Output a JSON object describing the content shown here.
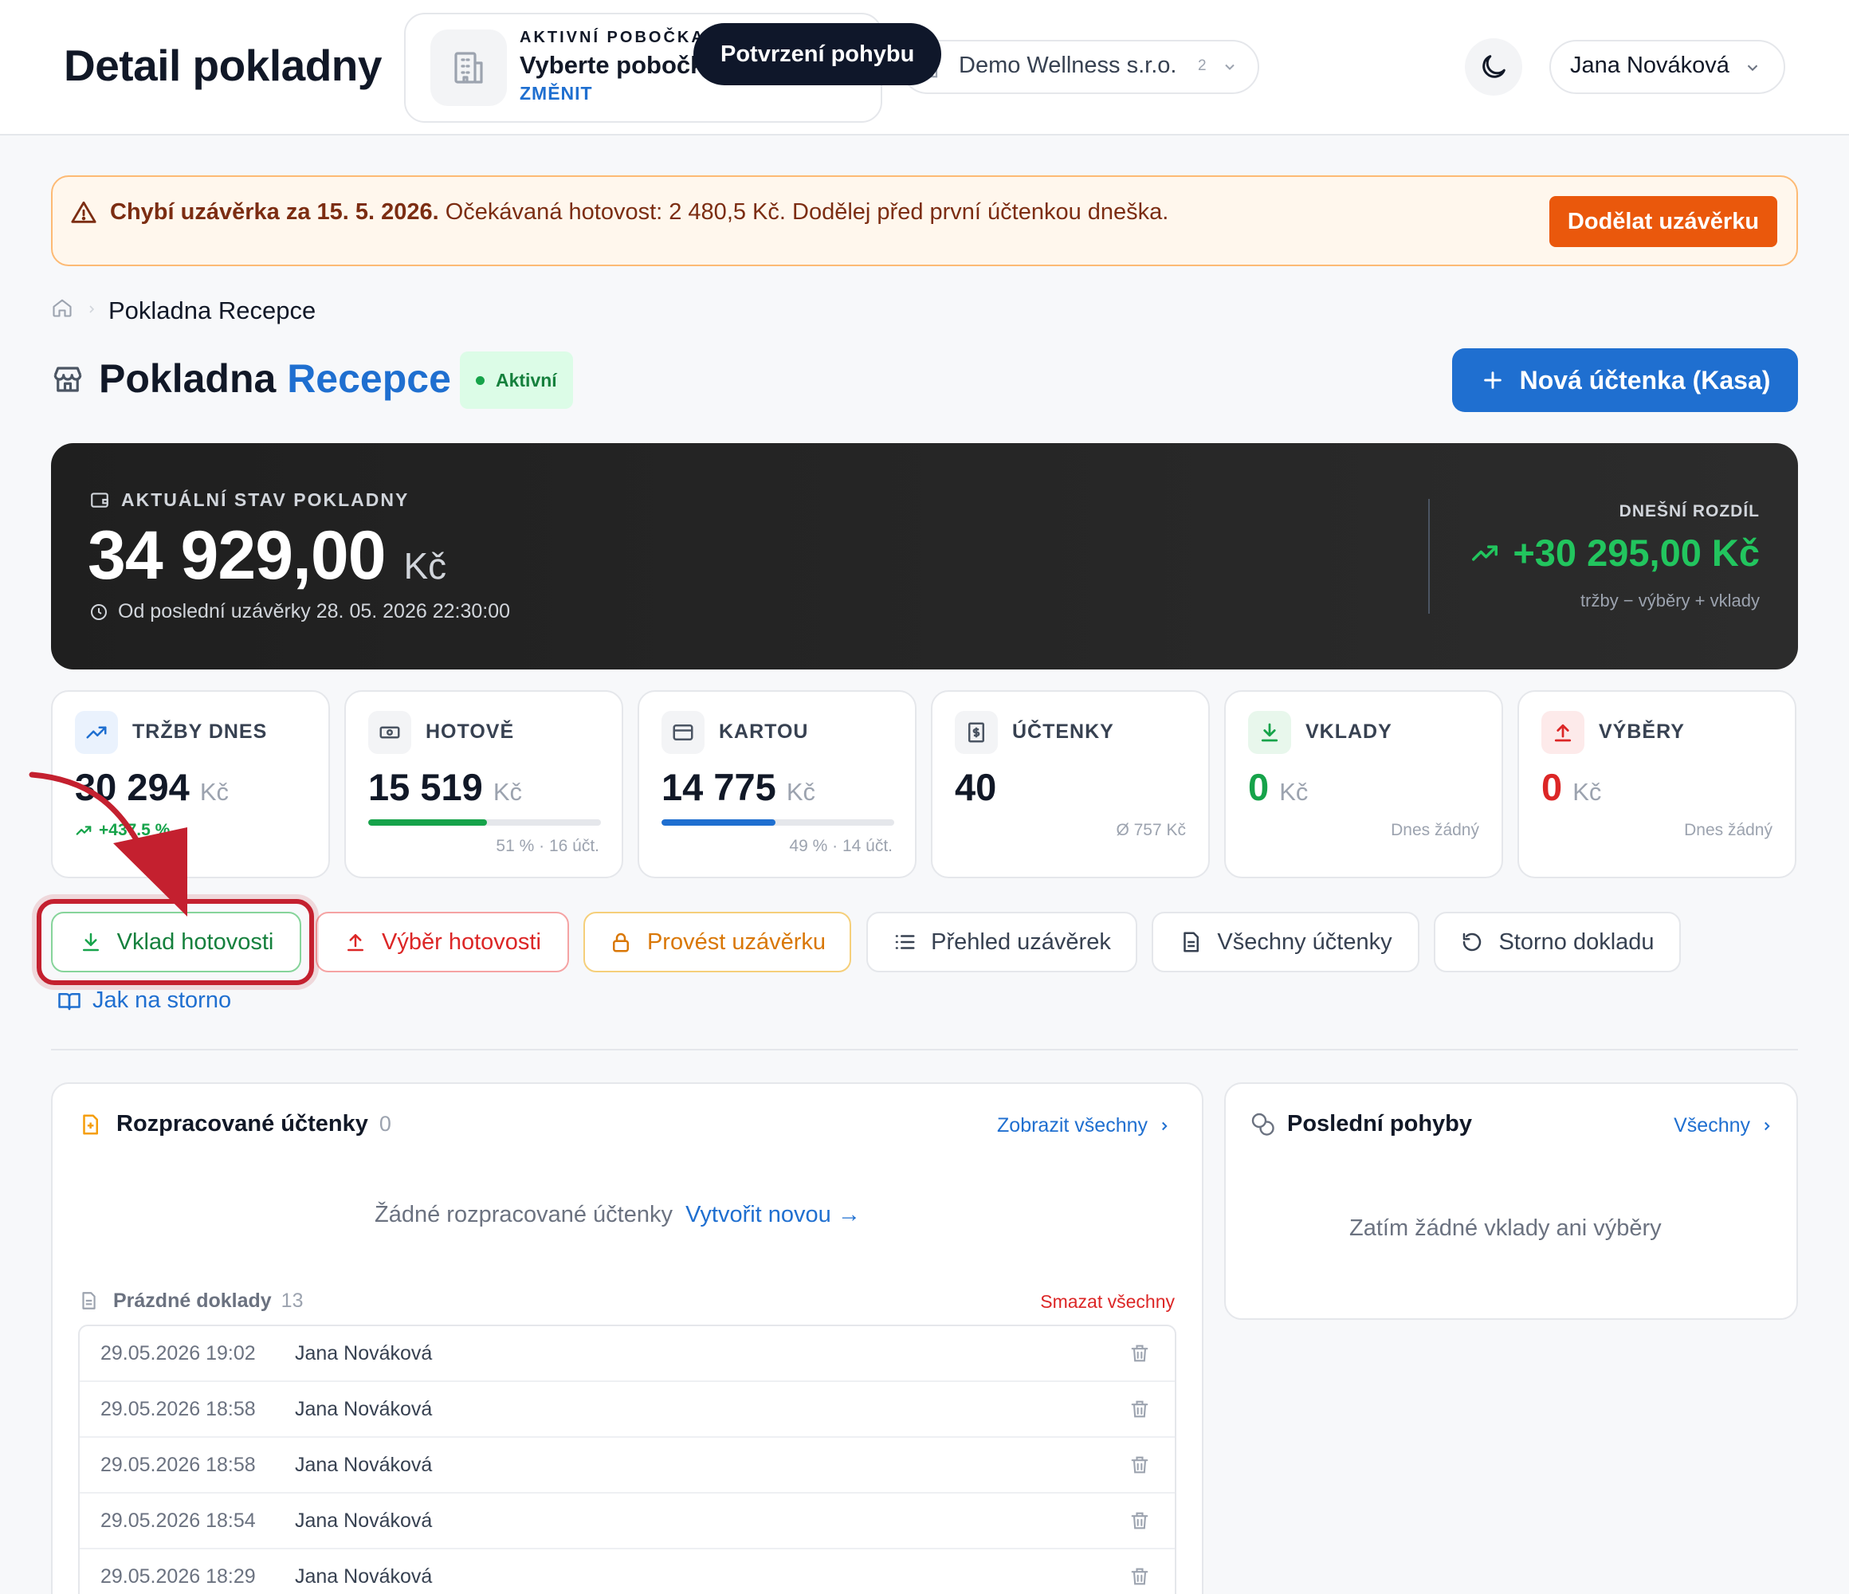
{
  "header": {
    "title": "Detail pokladny",
    "branch_label": "AKTIVNÍ POBOČKA",
    "branch_value": "Vyberte pobočku",
    "branch_change": "ZMĚNIT",
    "tooltip": "Potvrzení pohybu",
    "org_name": "Demo Wellness s.r.o.",
    "org_count": "2",
    "user_name": "Jana Nováková"
  },
  "warning": {
    "bold": "Chybí uzávěrka za 15. 5. 2026.",
    "text": " Očekávaná hotovost: 2 480,5 Kč. Dodělej před první účtenkou dneška.",
    "button": "Dodělat uzávěrku"
  },
  "breadcrumb": {
    "current": "Pokladna Recepce"
  },
  "page": {
    "title_main": "Pokladna ",
    "title_accent": "Recepce",
    "status": "Aktivní",
    "new_button": "Nová účtenka (Kasa)"
  },
  "balance": {
    "label": "AKTUÁLNÍ STAV POKLADNY",
    "value": "34 929,00",
    "unit": "Kč",
    "since": "Od poslední uzávěrky 28. 05. 2026 22:30:00",
    "diff_label": "DNEŠNÍ ROZDÍL",
    "diff_value": "+30 295,00 Kč",
    "diff_note": "tržby − výběry + vklady"
  },
  "stats": {
    "sales": {
      "label": "TRŽBY DNES",
      "value": "30 294",
      "unit": "Kč",
      "trend": "+437.5 %"
    },
    "cash": {
      "label": "HOTOVĚ",
      "value": "15 519",
      "unit": "Kč",
      "share": 0.51,
      "sub": "51 % · 16 účt."
    },
    "card": {
      "label": "KARTOU",
      "value": "14 775",
      "unit": "Kč",
      "share": 0.49,
      "sub": "49 % · 14 účt."
    },
    "receipts": {
      "label": "ÚČTENKY",
      "value": "40",
      "sub": "Ø 757 Kč"
    },
    "deposits": {
      "label": "VKLADY",
      "value": "0",
      "unit": "Kč",
      "sub": "Dnes žádný"
    },
    "withdrawals": {
      "label": "VÝBĚRY",
      "value": "0",
      "unit": "Kč",
      "sub": "Dnes žádný"
    }
  },
  "actions": {
    "deposit": "Vklad hotovosti",
    "withdraw": "Výběr hotovosti",
    "close": "Provést uzávěrku",
    "closings": "Přehled uzávěrek",
    "receipts": "Všechny účtenky",
    "storno": "Storno dokladu",
    "help": "Jak na storno"
  },
  "drafts": {
    "title": "Rozpracované účtenky",
    "count": "0",
    "link": "Zobrazit všechny",
    "empty": "Žádné rozpracované účtenky",
    "create": "Vytvořit novou →",
    "empty_docs_title": "Prázdné doklady",
    "empty_docs_count": "13",
    "delete_all": "Smazat všechny",
    "rows": [
      {
        "date": "29.05.2026 19:02",
        "user": "Jana Nováková"
      },
      {
        "date": "29.05.2026 18:58",
        "user": "Jana Nováková"
      },
      {
        "date": "29.05.2026 18:58",
        "user": "Jana Nováková"
      },
      {
        "date": "29.05.2026 18:54",
        "user": "Jana Nováková"
      },
      {
        "date": "29.05.2026 18:29",
        "user": "Jana Nováková"
      }
    ]
  },
  "movements": {
    "title": "Poslední pohyby",
    "link": "Všechny",
    "empty": "Zatím žádné vklady ani výběry"
  },
  "colors": {
    "accent": "#1f6fd0",
    "success": "#16a34a",
    "danger": "#dc2626",
    "warning": "#ea580c",
    "highlight": "#c4202f"
  }
}
